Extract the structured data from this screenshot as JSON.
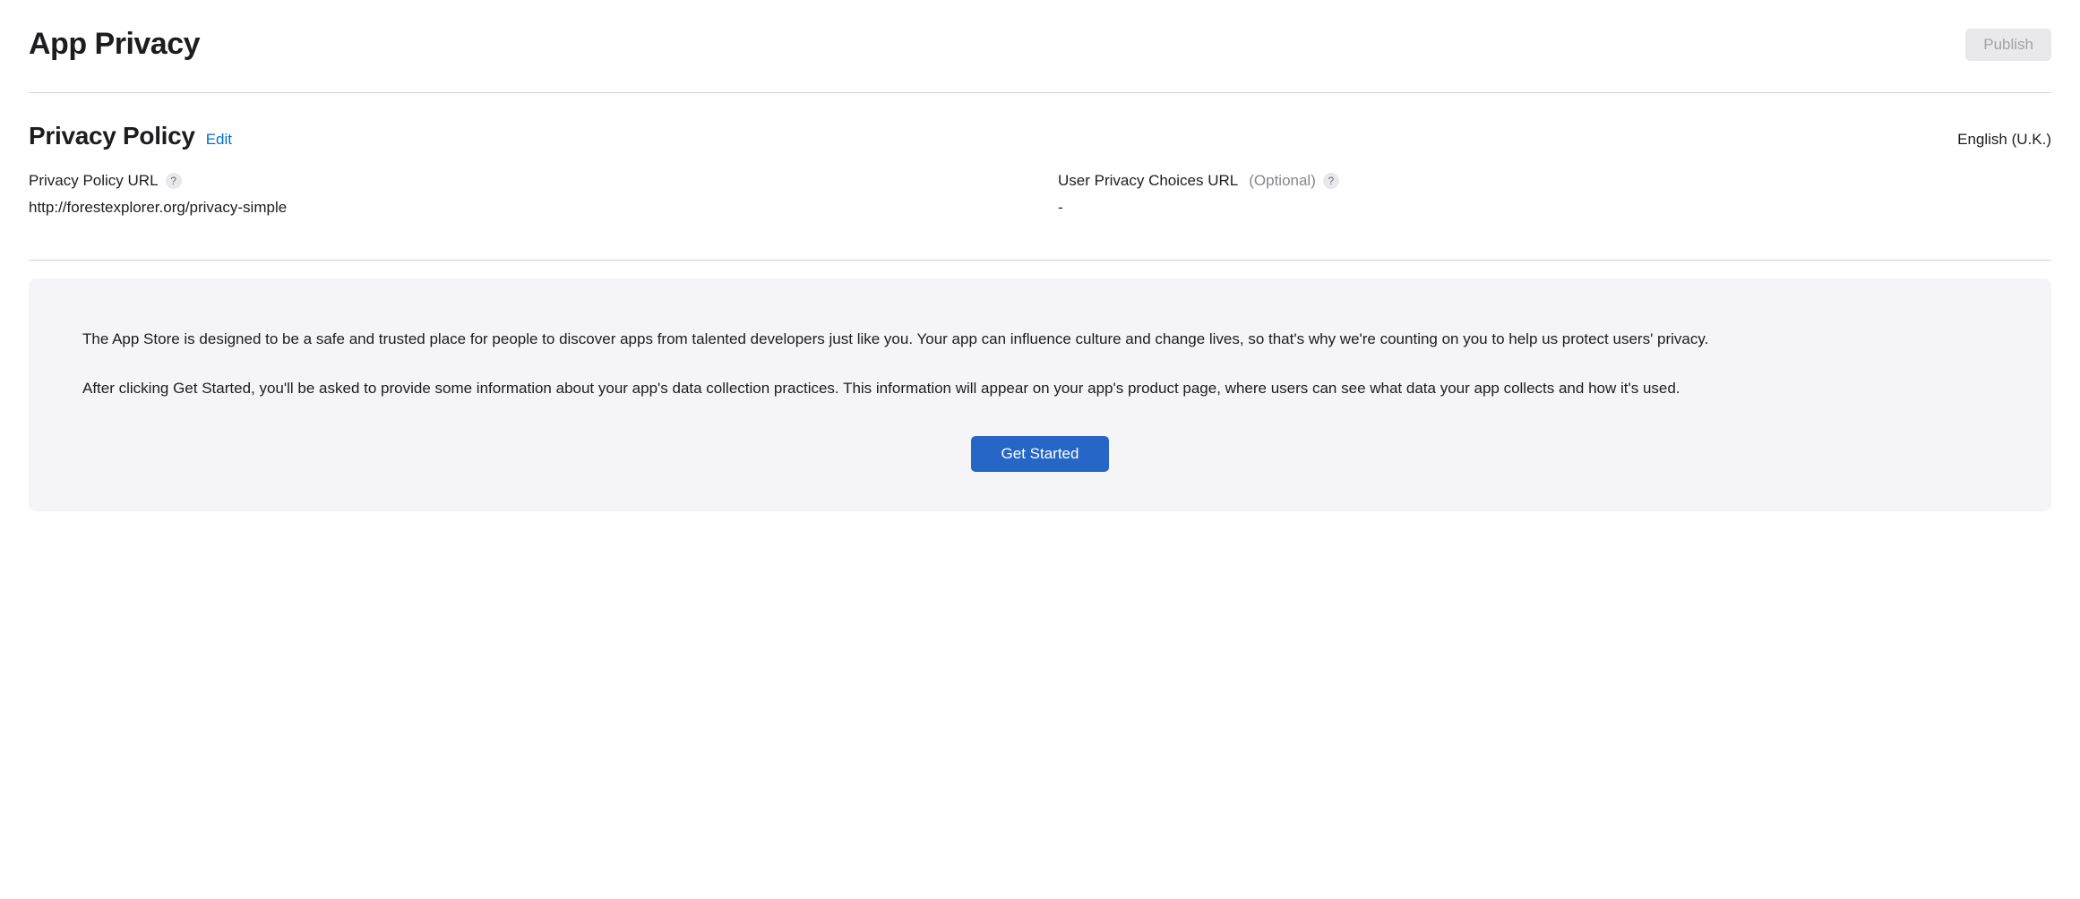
{
  "header": {
    "title": "App Privacy",
    "publish_label": "Publish"
  },
  "privacy_section": {
    "title": "Privacy Policy",
    "edit_label": "Edit",
    "locale": "English (U.K.)",
    "policy_url": {
      "label": "Privacy Policy URL",
      "value": "http://forestexplorer.org/privacy-simple"
    },
    "choices_url": {
      "label": "User Privacy Choices URL",
      "optional_label": "(Optional)",
      "value": "-"
    }
  },
  "info_box": {
    "paragraph1": "The App Store is designed to be a safe and trusted place for people to discover apps from talented developers just like you. Your app can influence culture and change lives, so that's why we're counting on you to help us protect users' privacy.",
    "paragraph2": "After clicking Get Started, you'll be asked to provide some information about your app's data collection practices. This information will appear on your app's product page, where users can see what data your app collects and how it's used.",
    "get_started_label": "Get Started"
  },
  "icons": {
    "help": "?"
  }
}
